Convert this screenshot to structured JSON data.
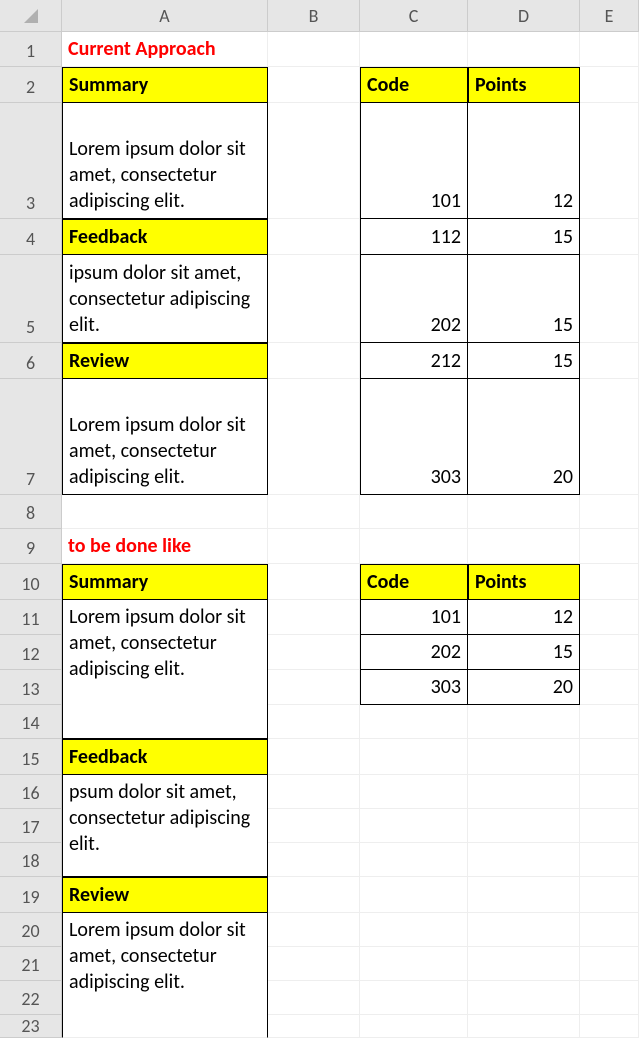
{
  "columns": [
    "A",
    "B",
    "C",
    "D",
    "E"
  ],
  "rows": [
    "1",
    "2",
    "3",
    "4",
    "5",
    "6",
    "7",
    "8",
    "9",
    "10",
    "11",
    "12",
    "13",
    "14",
    "15",
    "16",
    "17",
    "18",
    "19",
    "20",
    "21",
    "22",
    "23"
  ],
  "r1": {
    "a": "Current Approach"
  },
  "r2": {
    "a": "Summary",
    "c": "Code",
    "d": "Points"
  },
  "r3": {
    "a": "Lorem ipsum dolor sit amet, consectetur adipiscing elit.",
    "c": "101",
    "d": "12"
  },
  "r4": {
    "a": "Feedback",
    "c": "112",
    "d": "15"
  },
  "r5": {
    "a": "ipsum dolor sit amet, consectetur adipiscing elit.",
    "c": "202",
    "d": "15"
  },
  "r6": {
    "a": "Review",
    "c": "212",
    "d": "15"
  },
  "r7": {
    "a": "Lorem ipsum dolor sit amet, consectetur adipiscing elit.",
    "c": "303",
    "d": "20"
  },
  "r9": {
    "a": "to be done like"
  },
  "r10": {
    "a": "Summary",
    "c": "Code",
    "d": "Points"
  },
  "r11": {
    "a": "Lorem ipsum dolor sit amet, consectetur adipiscing elit.",
    "c": "101",
    "d": "12"
  },
  "r12": {
    "c": "202",
    "d": "15"
  },
  "r13": {
    "c": "303",
    "d": "20"
  },
  "r15": {
    "a": "Feedback"
  },
  "r16": {
    "a": "psum dolor sit amet, consectetur adipiscing elit."
  },
  "r19": {
    "a": "Review"
  },
  "r20": {
    "a": "Lorem ipsum dolor sit amet, consectetur adipiscing elit."
  },
  "row_heights": {
    "r3": 116,
    "r5": 88,
    "r7": 116
  }
}
